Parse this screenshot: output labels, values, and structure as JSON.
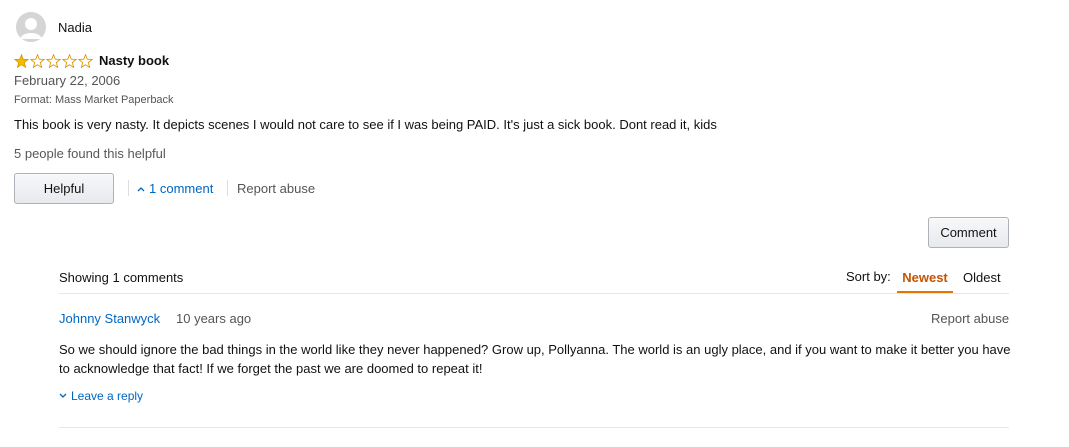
{
  "review": {
    "reviewer_name": "Nadia",
    "rating": 1,
    "rating_max": 5,
    "title": "Nasty book",
    "date": "February 22, 2006",
    "format": "Format: Mass Market Paperback",
    "body": "This book is very nasty. It depicts scenes I would not care to see if I was being PAID. It's just a sick book. Dont read it, kids",
    "helpful_count_text": "5 people found this helpful",
    "helpful_button_label": "Helpful",
    "comments_toggle_label": "1 comment",
    "report_abuse_label": "Report abuse"
  },
  "comments_section": {
    "comment_button_label": "Comment",
    "showing_text": "Showing 1 comments",
    "sort_label": "Sort by:",
    "sort_options": [
      "Newest",
      "Oldest"
    ],
    "sort_selected": "Newest",
    "comments": [
      {
        "author": "Johnny Stanwyck",
        "time": "10 years ago",
        "report_abuse_label": "Report abuse",
        "text": "So we should ignore the bad things in the world like they never happened? Grow up, Pollyanna. The world is an ugly place, and if you want to make it better you have to acknowledge that fact! If we forget the past we are doomed to repeat it!",
        "reply_label": "Leave a reply"
      }
    ]
  },
  "colors": {
    "link": "#0066c0",
    "star_filled": "#f7b800",
    "sort_active": "#c45500"
  },
  "icons": {
    "avatar": "avatar-icon",
    "star": "star-icon",
    "toggle": "chevron-up-icon",
    "reply": "chevron-down-icon"
  }
}
